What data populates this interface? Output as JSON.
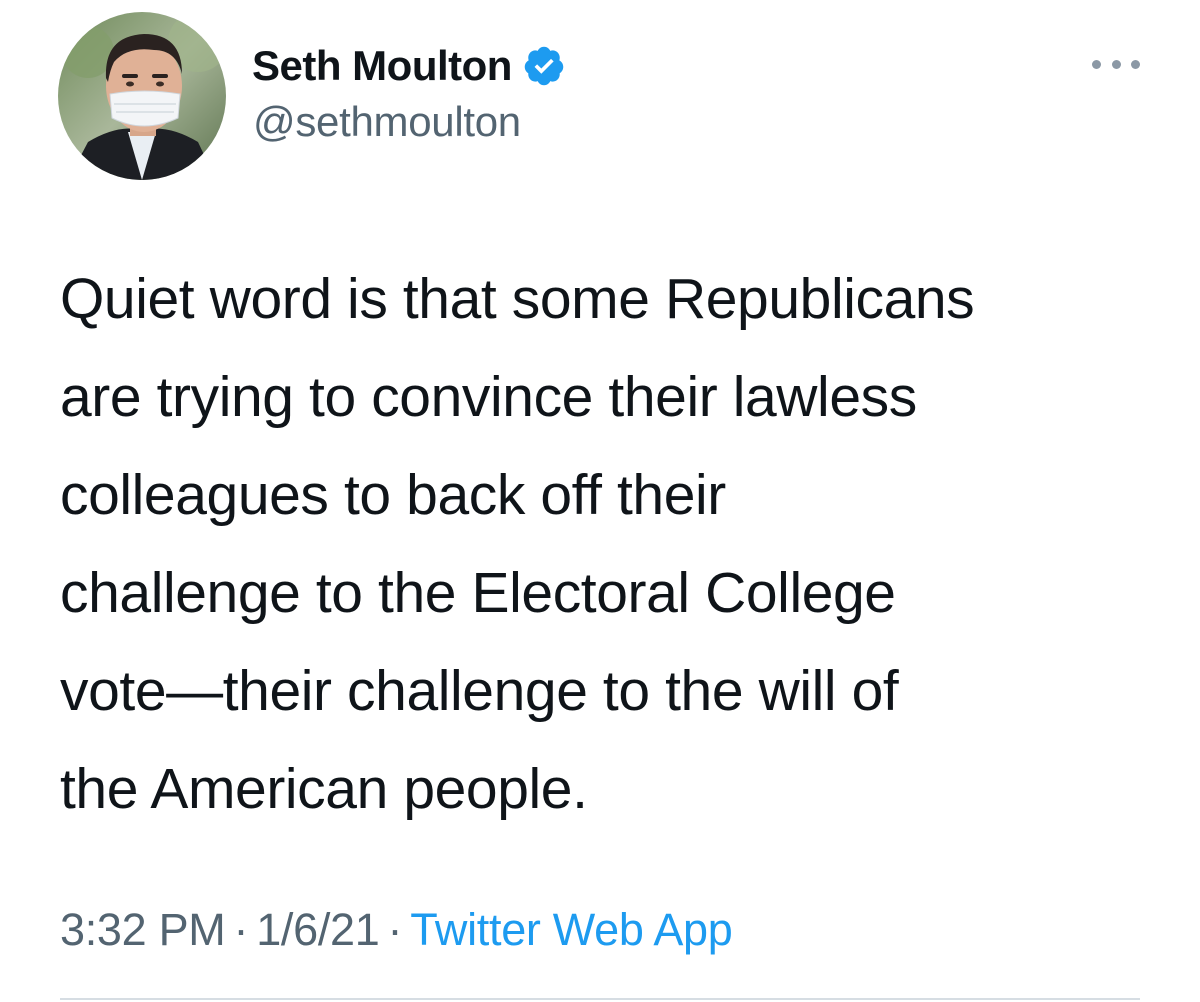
{
  "author": {
    "display_name": "Seth Moulton",
    "handle": "@sethmoulton",
    "verified": true,
    "avatar_icon": "profile-photo-masked-man"
  },
  "tweet": {
    "text_lines": [
      "Quiet word is that some Republicans",
      "are trying to convince their lawless",
      "colleagues to back off their",
      "challenge to the Electoral College",
      "vote—their challenge to the will of",
      "the American people."
    ],
    "time": "3:32 PM",
    "date": "1/6/21",
    "separator": "·",
    "source": "Twitter Web App"
  },
  "icons": {
    "verified": "verified-badge-icon",
    "more": "more-options-icon"
  },
  "colors": {
    "text_primary": "#0f1419",
    "text_secondary": "#536471",
    "accent": "#1d9bf0",
    "divider": "#d6dde3"
  }
}
